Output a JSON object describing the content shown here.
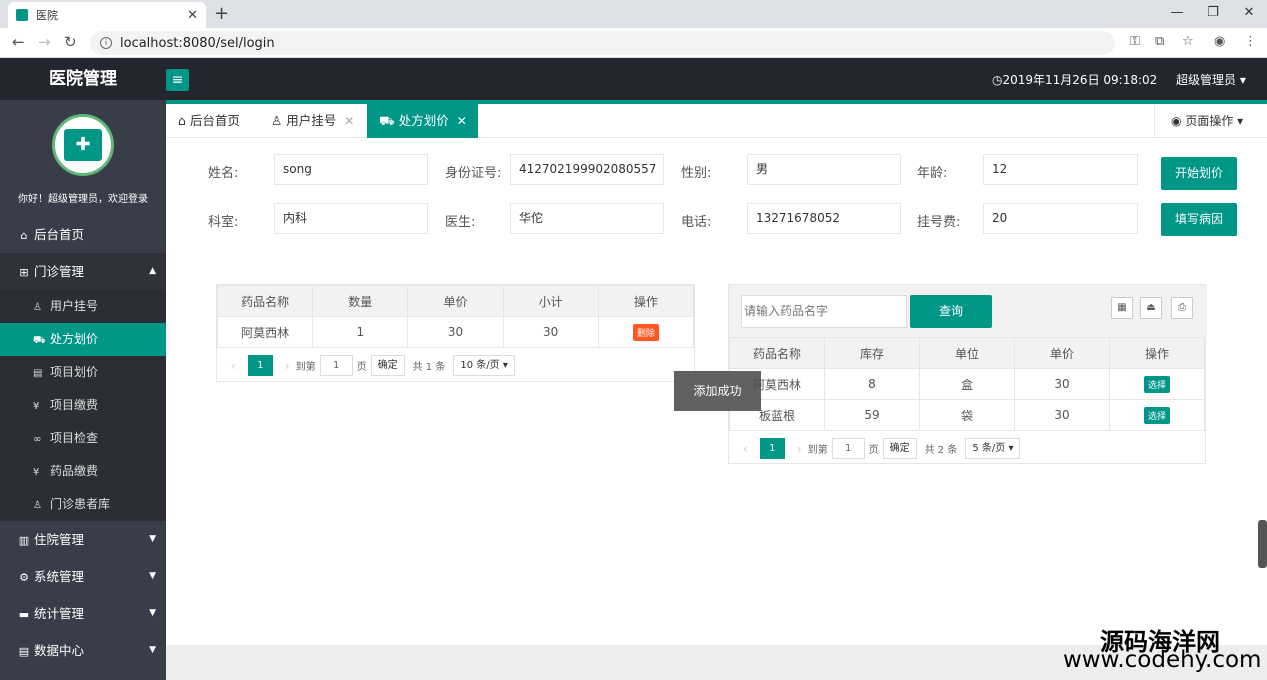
{
  "browser": {
    "tab_title": "医院",
    "url": "localhost:8080/sel/login"
  },
  "app": {
    "title": "医院管理",
    "clock": "2019年11月26日 09:18:02",
    "user": "超级管理员"
  },
  "sidebar": {
    "welcome": "你好！超级管理员，欢迎登录",
    "home": "后台首页",
    "clinic": "门诊管理",
    "subs": [
      "用户挂号",
      "处方划价",
      "项目划价",
      "项目缴费",
      "项目检查",
      "药品缴费",
      "门诊患者库"
    ],
    "inpatient": "住院管理",
    "system": "系统管理",
    "stats": "统计管理",
    "data": "数据中心"
  },
  "tabs": [
    "后台首页",
    "用户挂号",
    "处方划价"
  ],
  "page_ops": "页面操作",
  "form": {
    "name_label": "姓名:",
    "name": "song",
    "id_label": "身份证号:",
    "id": "412702199902080557",
    "gender_label": "性别:",
    "gender": "男",
    "age_label": "年龄:",
    "age": "12",
    "dept_label": "科室:",
    "dept": "内科",
    "doctor_label": "医生:",
    "doctor": "华佗",
    "phone_label": "电话:",
    "phone": "13271678052",
    "fee_label": "挂号费:",
    "fee": "20",
    "start_btn": "开始划价",
    "cause_btn": "填写病因"
  },
  "left_table": {
    "headers": [
      "药品名称",
      "数量",
      "单价",
      "小计",
      "操作"
    ],
    "rows": [
      {
        "name": "阿莫西林",
        "qty": "1",
        "price": "30",
        "subtotal": "30",
        "action": "删除"
      }
    ],
    "pager": {
      "page": "1",
      "goto": "到第",
      "page_unit": "页",
      "confirm": "确定",
      "total": "共 1 条",
      "size": "10 条/页"
    }
  },
  "right": {
    "search_placeholder": "请输入药品名字",
    "search_btn": "查询",
    "headers": [
      "药品名称",
      "库存",
      "单位",
      "单价",
      "操作"
    ],
    "rows": [
      {
        "name": "阿莫西林",
        "stock": "8",
        "unit": "盒",
        "price": "30",
        "action": "选择"
      },
      {
        "name": "板蓝根",
        "stock": "59",
        "unit": "袋",
        "price": "30",
        "action": "选择"
      }
    ],
    "pager": {
      "page": "1",
      "goto": "到第",
      "page_unit": "页",
      "confirm": "确定",
      "total": "共 2 条",
      "size": "5 条/页"
    }
  },
  "toast": "添加成功",
  "watermark": {
    "line1": "源码海洋网",
    "line2": "www.codehy.com"
  }
}
